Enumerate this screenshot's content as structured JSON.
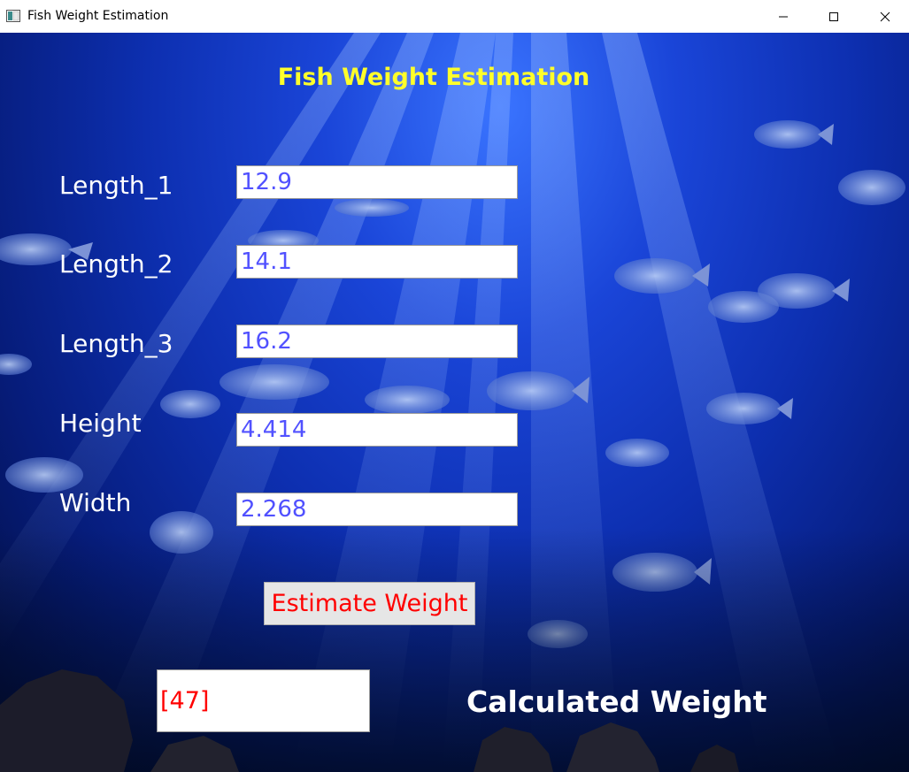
{
  "window": {
    "title": "Fish Weight Estimation",
    "icon": "app-window-icon",
    "controls": {
      "minimize_icon": "minimize-icon",
      "maximize_icon": "maximize-icon",
      "close_icon": "close-icon"
    }
  },
  "app": {
    "heading": "Fish Weight Estimation",
    "heading_color": "#ffff2a",
    "fields": [
      {
        "label": "Length_1",
        "value": "12.9"
      },
      {
        "label": "Length_2",
        "value": "14.1"
      },
      {
        "label": "Length_3",
        "value": "16.2"
      },
      {
        "label": "Height",
        "value": "4.414"
      },
      {
        "label": "Width",
        "value": "2.268"
      }
    ],
    "estimate_button_label": "Estimate Weight",
    "result_value": "[47]",
    "result_label": "Calculated Weight",
    "colors": {
      "input_text": "#5151ff",
      "accent_red": "#ff0000",
      "label_white": "#ffffff"
    }
  }
}
